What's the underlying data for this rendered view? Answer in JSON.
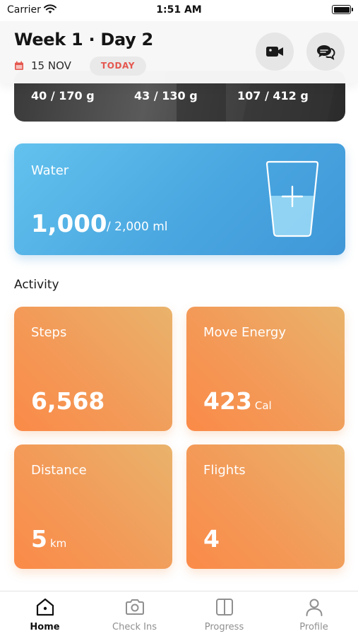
{
  "status_bar": {
    "carrier": "Carrier",
    "time": "1:51 AM"
  },
  "header": {
    "title": "Week 1 · Day 2",
    "date": "15 NOV",
    "badge": "TODAY",
    "video_icon": "video-camera-icon",
    "chat_icon": "chat-bubbles-icon"
  },
  "macros": {
    "carbs": "40 / 170 g",
    "protein": "43 / 130 g",
    "fat": "107 / 412 g"
  },
  "water": {
    "label": "Water",
    "value": "1,000",
    "goal": "/  2,000 ml",
    "icon": "water-glass-plus-icon"
  },
  "activity": {
    "title": "Activity",
    "steps": {
      "label": "Steps",
      "value": "6,568",
      "unit": ""
    },
    "move_energy": {
      "label": "Move Energy",
      "value": "423",
      "unit": "Cal"
    },
    "distance": {
      "label": "Distance",
      "value": "5",
      "unit": "km"
    },
    "flights": {
      "label": "Flights",
      "value": "4",
      "unit": ""
    }
  },
  "tabs": [
    {
      "label": "Home",
      "icon": "home-icon",
      "active": true
    },
    {
      "label": "Check Ins",
      "icon": "camera-icon",
      "active": false
    },
    {
      "label": "Progress",
      "icon": "progress-book-icon",
      "active": false
    },
    {
      "label": "Profile",
      "icon": "profile-icon",
      "active": false
    }
  ],
  "colors": {
    "water_card": "#4aa7e0",
    "activity_card": "#f39a58",
    "today_badge_text": "#e4574f"
  }
}
